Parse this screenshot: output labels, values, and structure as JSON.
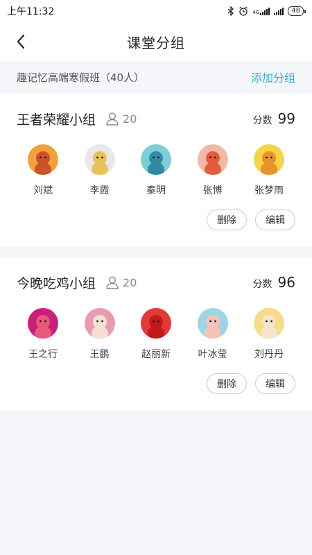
{
  "status": {
    "time": "上午11:32",
    "network": "4G",
    "battery": "48"
  },
  "nav": {
    "title": "课堂分组"
  },
  "class_bar": {
    "class_name": "趣记忆高端寒假班（40人）",
    "add_label": "添加分组"
  },
  "groups": [
    {
      "name": "王者荣耀小组",
      "count": "20",
      "score_label": "分数",
      "score": "99",
      "members": [
        {
          "name": "刘斌",
          "avatar_bg": "#f0a13a",
          "avatar_fg": "#c9542a"
        },
        {
          "name": "李霞",
          "avatar_bg": "#e8e8e8",
          "avatar_fg": "#e6c15a"
        },
        {
          "name": "秦明",
          "avatar_bg": "#7ccfd6",
          "avatar_fg": "#2f8aa2"
        },
        {
          "name": "张博",
          "avatar_bg": "#f2b9a8",
          "avatar_fg": "#e25d3b"
        },
        {
          "name": "张梦雨",
          "avatar_bg": "#f7d24a",
          "avatar_fg": "#e8922e"
        }
      ],
      "delete_label": "删除",
      "edit_label": "编辑"
    },
    {
      "name": "今晚吃鸡小组",
      "count": "20",
      "score_label": "分数",
      "score": "96",
      "members": [
        {
          "name": "王之行",
          "avatar_bg": "#c8207a",
          "avatar_fg": "#e8587a"
        },
        {
          "name": "王鹏",
          "avatar_bg": "#e89ab0",
          "avatar_fg": "#f4e0d0"
        },
        {
          "name": "赵丽新",
          "avatar_bg": "#e23a3a",
          "avatar_fg": "#c21a1a"
        },
        {
          "name": "叶冰莹",
          "avatar_bg": "#9ed4e6",
          "avatar_fg": "#f4c4b8"
        },
        {
          "name": "刘丹丹",
          "avatar_bg": "#f4dc8a",
          "avatar_fg": "#f6e4c8"
        }
      ],
      "delete_label": "删除",
      "edit_label": "编辑"
    }
  ]
}
